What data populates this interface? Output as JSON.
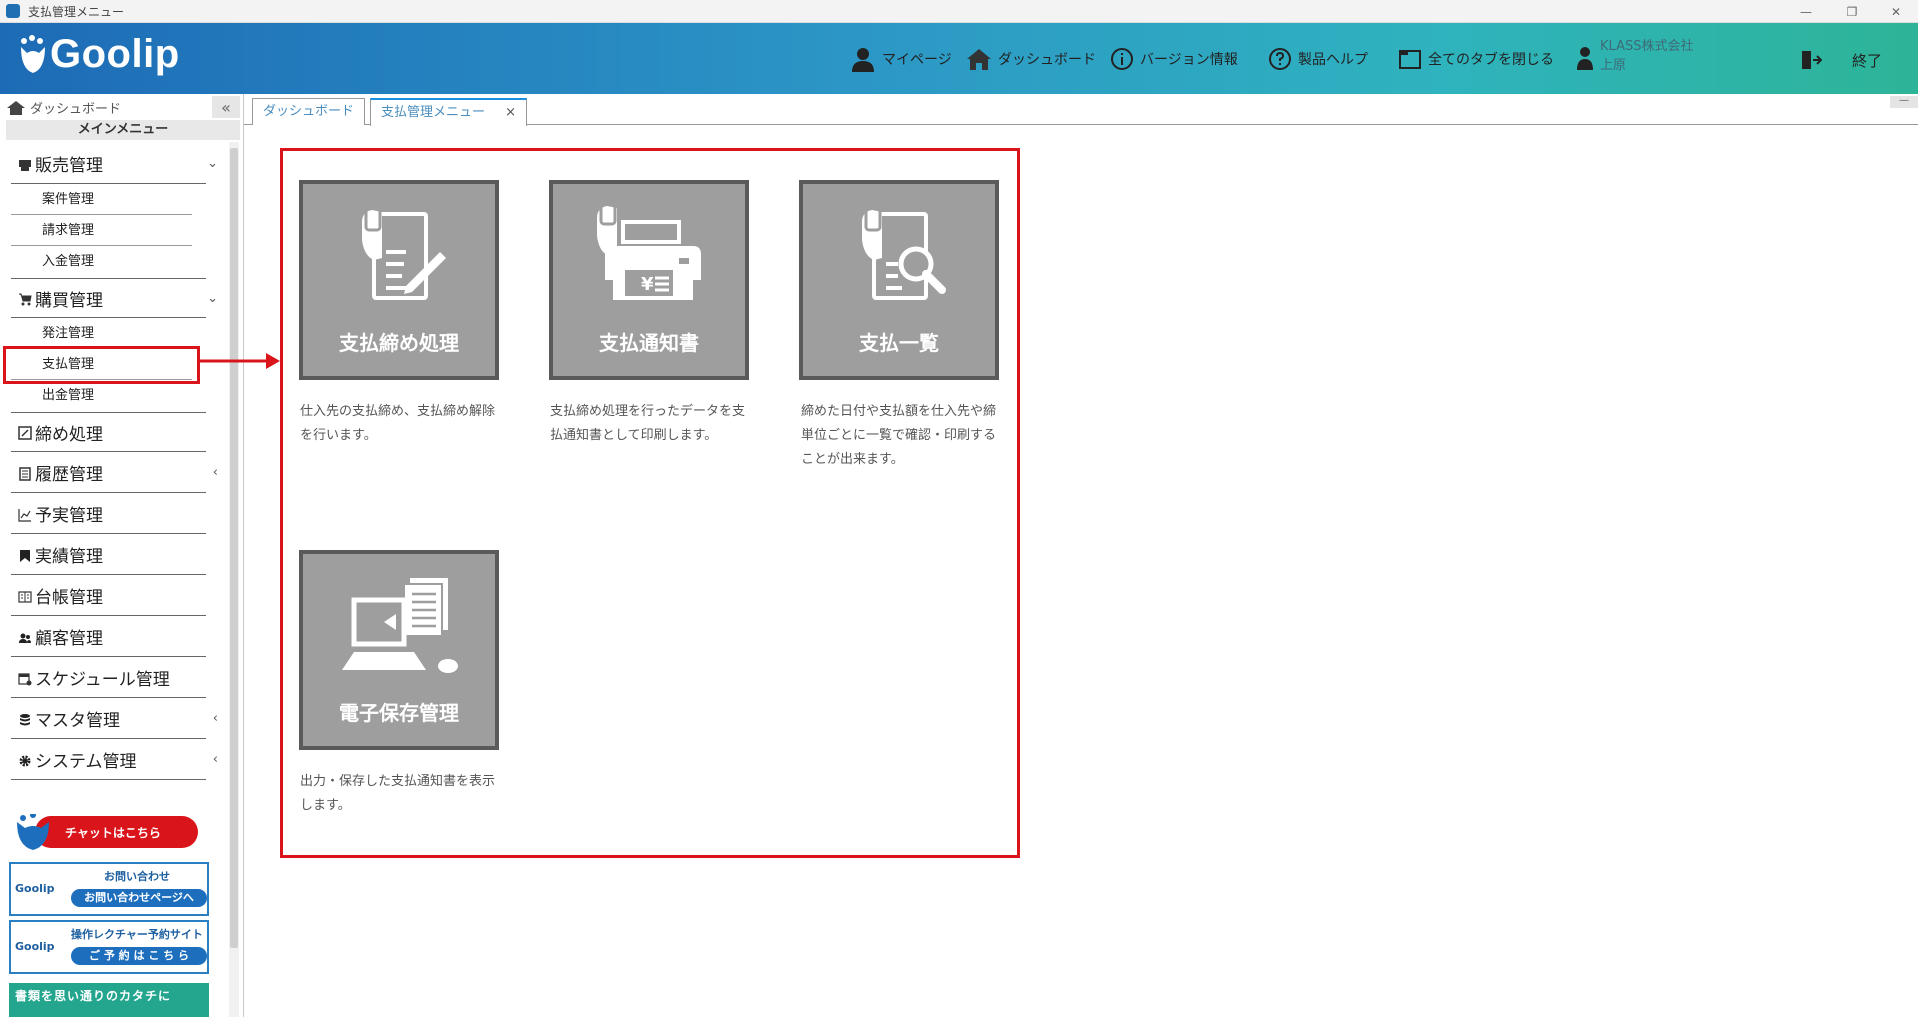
{
  "window": {
    "title": "支払管理メニュー",
    "minimize": "—",
    "restore": "❐",
    "close": "✕"
  },
  "header": {
    "logo": "Goolip",
    "nav": [
      {
        "label": "マイページ",
        "icon": "user-icon"
      },
      {
        "label": "ダッシュボード",
        "icon": "home-icon"
      },
      {
        "label": "バージョン情報",
        "icon": "info-icon"
      },
      {
        "label": "製品ヘルプ",
        "icon": "help-icon"
      },
      {
        "label": "全てのタブを閉じる",
        "icon": "folder-icon"
      }
    ],
    "company_name": "KLASS株式会社",
    "user_name": "上原",
    "exit_label": "終了"
  },
  "sidebar": {
    "dashboard": "ダッシュボード",
    "main_menu": "メインメニュー",
    "groups": [
      {
        "label": "販売管理",
        "icon": "register-icon",
        "expanded": true
      },
      {
        "label": "購買管理",
        "icon": "cart-icon",
        "expanded": true
      },
      {
        "label": "締め処理",
        "icon": "edit-icon"
      },
      {
        "label": "履歴管理",
        "icon": "history-icon"
      },
      {
        "label": "予実管理",
        "icon": "chart-icon"
      },
      {
        "label": "実績管理",
        "icon": "bookmark-icon"
      },
      {
        "label": "台帳管理",
        "icon": "book-icon"
      },
      {
        "label": "顧客管理",
        "icon": "users-icon"
      },
      {
        "label": "スケジュール管理",
        "icon": "calendar-icon"
      },
      {
        "label": "マスタ管理",
        "icon": "database-icon"
      },
      {
        "label": "システム管理",
        "icon": "gear-icon"
      }
    ],
    "sales_items": [
      "案件管理",
      "請求管理",
      "入金管理"
    ],
    "purchase_items": [
      "発注管理",
      "支払管理",
      "出金管理"
    ],
    "selected_item": "支払管理"
  },
  "banners": {
    "chat": "チャットはこちら",
    "contact_logo": "Goolip",
    "contact_title": "お問い合わせ",
    "contact_button": "お問い合わせページへ",
    "lecture_logo": "Goolip",
    "lecture_title": "操作レクチャー予約サイト",
    "lecture_button": "ご 予 約 は こ ち ら",
    "design_text": "書類を思い通りのカタチに"
  },
  "tabs": [
    {
      "label": "ダッシュボード",
      "active": false
    },
    {
      "label": "支払管理メニュー",
      "active": true,
      "close": "×"
    }
  ],
  "tiles": [
    {
      "label": "支払締め処理",
      "icon": "payment-close-icon",
      "description": "仕入先の支払締め、支払締め解除を行います。"
    },
    {
      "label": "支払通知書",
      "icon": "payment-notice-icon",
      "description": "支払締め処理を行ったデータを支払通知書として印刷します。"
    },
    {
      "label": "支払一覧",
      "icon": "payment-list-icon",
      "description": "締めた日付や支払額を仕入先や締単位ごとに一覧で確認・印刷することが出来ます。"
    },
    {
      "label": "電子保存管理",
      "icon": "electronic-storage-icon",
      "description": "出力・保存した支払通知書を表示します。"
    }
  ],
  "colors": {
    "highlight": "#d9151b",
    "tile_bg": "#9e9e9e",
    "tab_active": "#1e8fe0"
  }
}
